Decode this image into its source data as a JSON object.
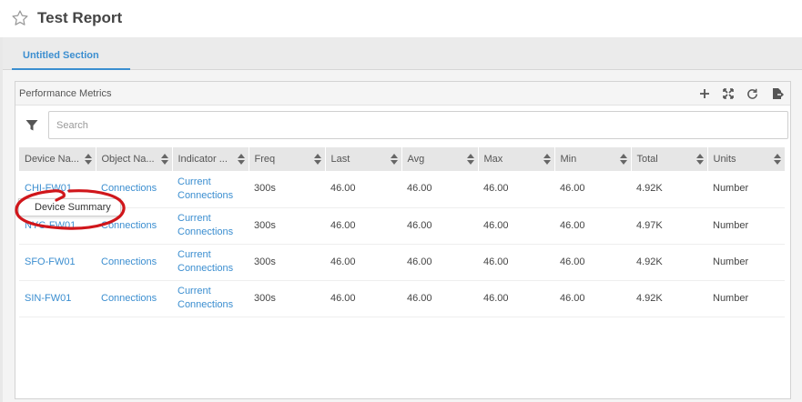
{
  "report": {
    "title": "Test Report",
    "star_icon": "star-icon"
  },
  "tabs": [
    {
      "label": "Untitled Section"
    }
  ],
  "panel": {
    "title": "Performance Metrics",
    "tools": [
      "add-icon",
      "expand-icon",
      "refresh-icon",
      "export-icon"
    ],
    "search": {
      "placeholder": "Search",
      "value": ""
    },
    "columns": [
      "Device Na...",
      "Object Na...",
      "Indicator ...",
      "Freq",
      "Last",
      "Avg",
      "Max",
      "Min",
      "Total",
      "Units"
    ],
    "rows": [
      {
        "device": "CHI-FW01",
        "object": "Connections",
        "indicator": "Current Connections",
        "freq": "300s",
        "last": "46.00",
        "avg": "46.00",
        "max": "46.00",
        "min": "46.00",
        "total": "4.92K",
        "units": "Number"
      },
      {
        "device": "NYC-FW01",
        "object": "Connections",
        "indicator": "Current Connections",
        "freq": "300s",
        "last": "46.00",
        "avg": "46.00",
        "max": "46.00",
        "min": "46.00",
        "total": "4.97K",
        "units": "Number"
      },
      {
        "device": "SFO-FW01",
        "object": "Connections",
        "indicator": "Current Connections",
        "freq": "300s",
        "last": "46.00",
        "avg": "46.00",
        "max": "46.00",
        "min": "46.00",
        "total": "4.92K",
        "units": "Number"
      },
      {
        "device": "SIN-FW01",
        "object": "Connections",
        "indicator": "Current Connections",
        "freq": "300s",
        "last": "46.00",
        "avg": "46.00",
        "max": "46.00",
        "min": "46.00",
        "total": "4.92K",
        "units": "Number"
      }
    ]
  },
  "tooltip": {
    "text": "Device Summary"
  },
  "colors": {
    "accent": "#3b8ed0",
    "annotation": "#d0161b"
  }
}
